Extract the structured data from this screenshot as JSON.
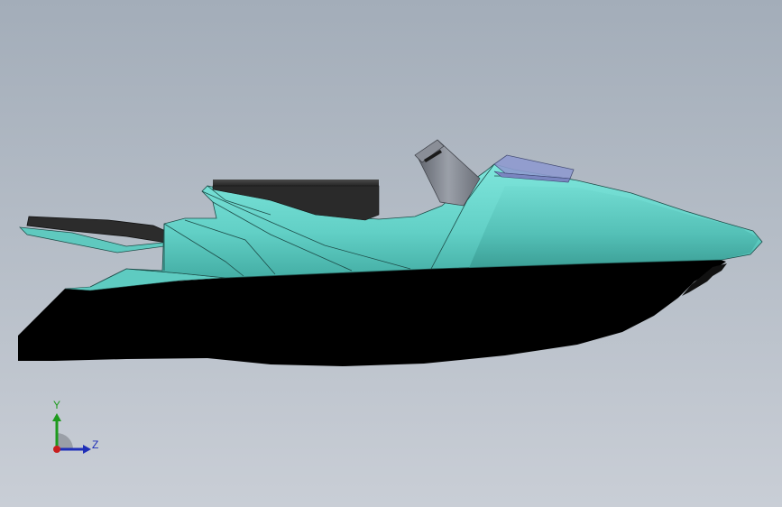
{
  "viewport": {
    "background_top": "#a3adb9",
    "background_bottom": "#c9ced6"
  },
  "model": {
    "subject": "jet-ski",
    "colors": {
      "deck": "#6fd8cf",
      "deck_shadow": "#3fa89f",
      "hull": "#000000",
      "seat": "#2b2b2b",
      "steering": "#7c8089",
      "windshield": "#8f9bd0"
    }
  },
  "triad": {
    "y_label": "Y",
    "z_label": "Z",
    "colors": {
      "y_axis": "#1d9a1d",
      "z_axis": "#1f2fb8",
      "origin": "#c81e1e"
    }
  }
}
